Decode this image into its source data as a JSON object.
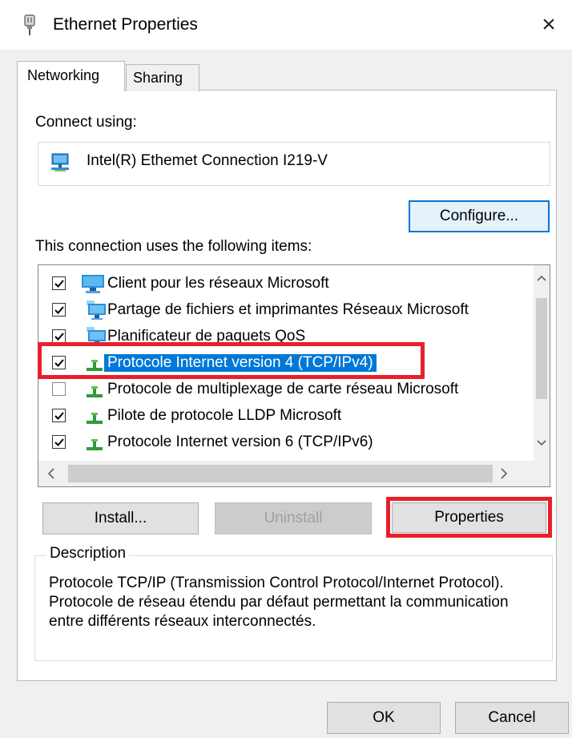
{
  "window": {
    "title": "Ethernet Properties",
    "close_glyph": "×"
  },
  "tabs": [
    {
      "label": "Networking",
      "active": true
    },
    {
      "label": "Sharing",
      "active": false
    }
  ],
  "connect": {
    "label": "Connect using:",
    "adapter_name": "Intel(R) Ethemet Connection I219-V",
    "configure_label": "Configure..."
  },
  "items": {
    "label": "This connection uses the following items:",
    "list": [
      {
        "label": "Client pour les réseaux Microsoft",
        "checked": true,
        "icon": "network-client-icon",
        "selected": false
      },
      {
        "label": "Partage de fichiers et imprimantes Réseaux Microsoft",
        "checked": true,
        "icon": "network-service-icon",
        "selected": false
      },
      {
        "label": "Planificateur de paquets QoS",
        "checked": true,
        "icon": "network-service-icon",
        "selected": false
      },
      {
        "label": "Protocole Internet version 4 (TCP/IPv4)",
        "checked": true,
        "icon": "protocol-icon",
        "selected": true
      },
      {
        "label": "Protocole de multiplexage de carte réseau Microsoft",
        "checked": false,
        "icon": "protocol-icon",
        "selected": false
      },
      {
        "label": "Pilote de protocole LLDP Microsoft",
        "checked": true,
        "icon": "protocol-icon",
        "selected": false
      },
      {
        "label": "Protocole Internet version 6 (TCP/IPv6)",
        "checked": true,
        "icon": "protocol-icon",
        "selected": false
      }
    ]
  },
  "buttons": {
    "install": "Install...",
    "uninstall": "Uninstall",
    "properties": "Properties",
    "ok": "OK",
    "cancel": "Cancel"
  },
  "description": {
    "legend": "Description",
    "text": "Protocole TCP/IP (Transmission Control Protocol/Internet Protocol). Protocole de réseau étendu par défaut permettant la communication entre différents réseaux interconnectés."
  },
  "colors": {
    "selection": "#0078d7",
    "highlight_red": "#e8202b"
  }
}
